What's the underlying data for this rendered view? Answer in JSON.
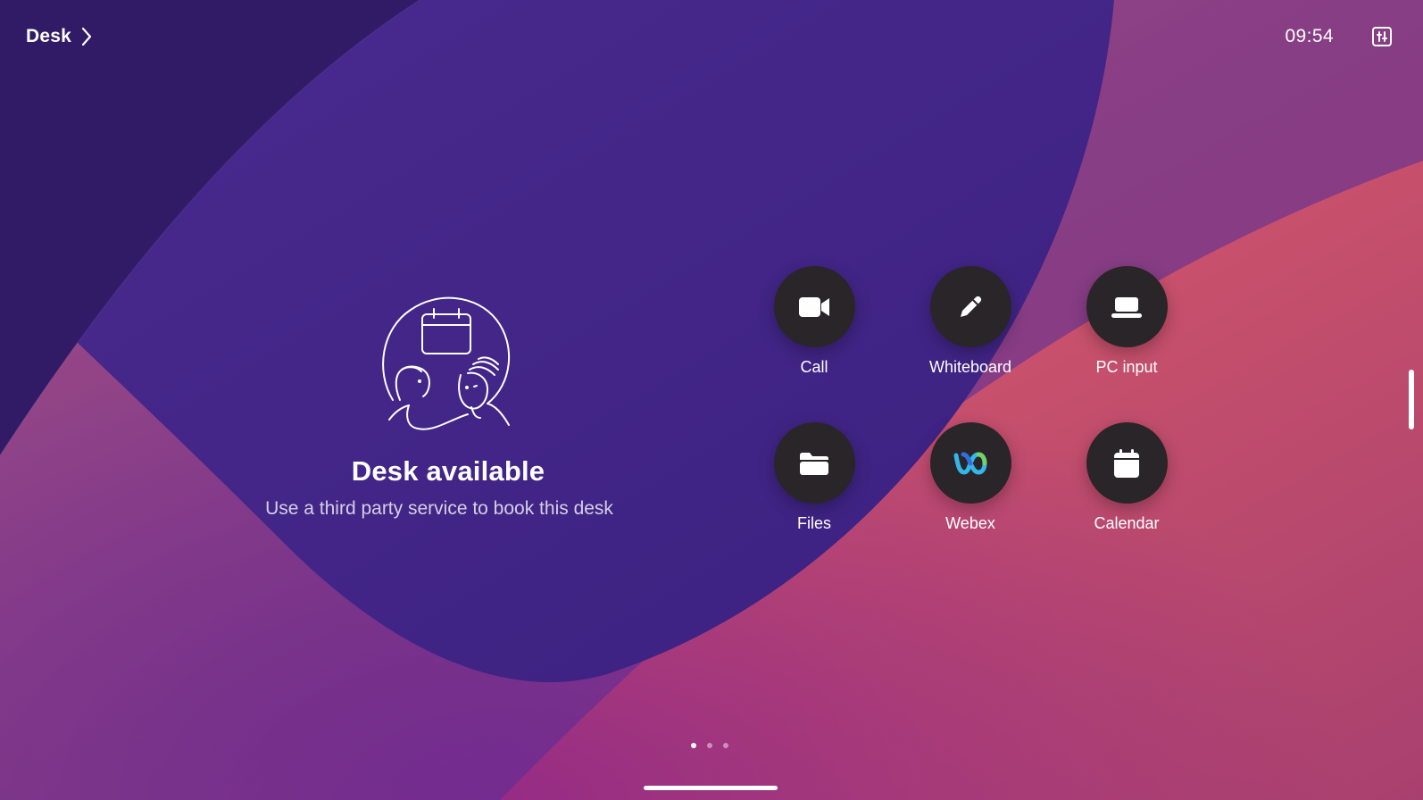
{
  "header": {
    "title": "Desk",
    "title_icon": "chevron-right-icon",
    "time": "09:54",
    "panel_icon": "control-panel-icon"
  },
  "status": {
    "illustration": "desk-booking-illustration",
    "title": "Desk available",
    "subtitle": "Use a third party service to book this desk"
  },
  "apps": [
    {
      "label": "Call",
      "icon": "video-camera-icon"
    },
    {
      "label": "Whiteboard",
      "icon": "pencil-icon"
    },
    {
      "label": "PC input",
      "icon": "laptop-icon"
    },
    {
      "label": "Files",
      "icon": "folder-icon"
    },
    {
      "label": "Webex",
      "icon": "webex-logo-icon"
    },
    {
      "label": "Calendar",
      "icon": "calendar-icon"
    }
  ],
  "pagination": {
    "pages": 3,
    "active": 1
  },
  "colors": {
    "app_circle": "#2a2528",
    "bg_purple_dark": "#321b66",
    "bg_purple": "#4a2a8f",
    "bg_coral": "#e26a58",
    "bg_pink": "#b4427a"
  }
}
